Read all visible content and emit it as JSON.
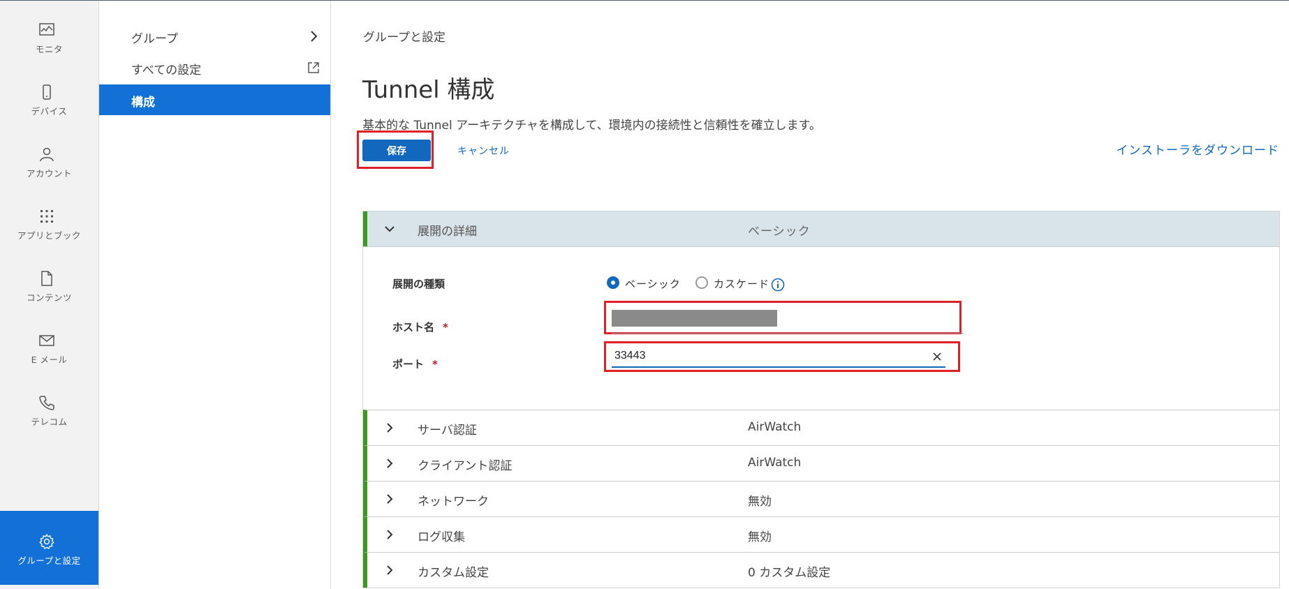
{
  "rail": {
    "items": [
      {
        "label": "モニタ",
        "icon": "monitor-chart-icon"
      },
      {
        "label": "デバイス",
        "icon": "phone-icon"
      },
      {
        "label": "アカウント",
        "icon": "user-icon"
      },
      {
        "label": "アプリとブック",
        "icon": "apps-grid-icon"
      },
      {
        "label": "コンテンツ",
        "icon": "document-icon"
      },
      {
        "label": "E メール",
        "icon": "envelope-icon"
      },
      {
        "label": "テレコム",
        "icon": "telephone-icon"
      },
      {
        "label": "グループと設定",
        "icon": "gear-icon",
        "active": true
      }
    ]
  },
  "subnav": {
    "items": [
      {
        "label": "グループ",
        "trail_icon": "chevron-right-icon"
      },
      {
        "label": "すべての設定",
        "trail_icon": "external-link-icon"
      },
      {
        "label": "構成",
        "active": true
      }
    ]
  },
  "main": {
    "breadcrumb": "グループと設定",
    "title": "Tunnel 構成",
    "description": "基本的な Tunnel アーキテクチャを構成して、環境内の接続性と信頼性を確立します。",
    "save_label": "保存",
    "cancel_label": "キャンセル",
    "download_label": "インストーラをダウンロード"
  },
  "accordion": {
    "expanded": {
      "name": "展開の詳細",
      "value": "ベーシック",
      "deploy_type_label": "展開の種類",
      "options": [
        "ベーシック",
        "カスケード"
      ],
      "selected_option": "ベーシック",
      "host_label": "ホスト名",
      "host_value": "",
      "port_label": "ポート",
      "port_value": "33443",
      "required_mark": "*"
    },
    "rows": [
      {
        "name": "サーバ認証",
        "value": "AirWatch"
      },
      {
        "name": "クライアント認証",
        "value": "AirWatch"
      },
      {
        "name": "ネットワーク",
        "value": "無効"
      },
      {
        "name": "ログ収集",
        "value": "無効"
      },
      {
        "name": "カスタム設定",
        "value": "0 カスタム設定"
      }
    ]
  },
  "colors": {
    "accent": "#1370d6",
    "link": "#1168bd",
    "highlight_border": "#e01f26",
    "section_marker": "#3a9a1f",
    "expanded_header_bg": "#d9e3ea"
  }
}
